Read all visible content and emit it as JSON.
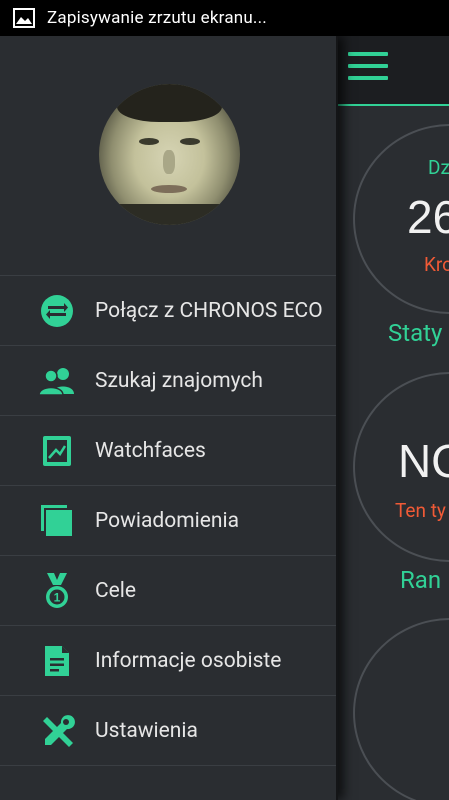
{
  "status_bar": {
    "notification_icon": "image-icon",
    "text": "Zapisywanie zrzutu ekranu..."
  },
  "background": {
    "menu_icon": "hamburger-icon",
    "stat1_label": "Dz",
    "stat1_value": "26",
    "stat1_sub": "Kro",
    "section1": "Staty",
    "stat2_value": "NO",
    "stat2_sub": "Ten ty",
    "section2": "Ran"
  },
  "drawer": {
    "avatar": "profile-photo",
    "items": [
      {
        "label": "Połącz z CHRONOS ECO",
        "icon": "connect-icon"
      },
      {
        "label": "Szukaj znajomych",
        "icon": "people-icon"
      },
      {
        "label": "Watchfaces",
        "icon": "watchface-icon"
      },
      {
        "label": "Powiadomienia",
        "icon": "notifications-icon"
      },
      {
        "label": "Cele",
        "icon": "medal-icon"
      },
      {
        "label": "Informacje osobiste",
        "icon": "document-icon"
      },
      {
        "label": "Ustawienia",
        "icon": "tools-icon"
      }
    ]
  },
  "colors": {
    "accent": "#31d196",
    "warning": "#f05a36",
    "drawer_bg": "#2a2d31",
    "divider": "#3a3e43",
    "text": "#e6e6e6"
  }
}
